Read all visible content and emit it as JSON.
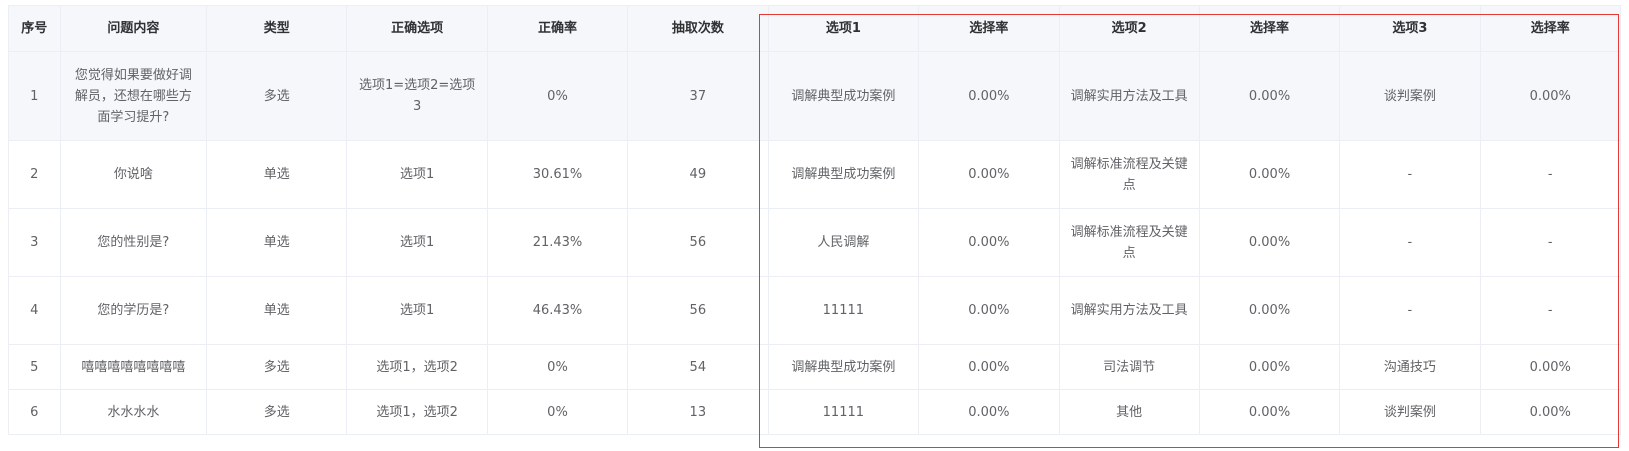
{
  "table": {
    "headers": [
      "序号",
      "问题内容",
      "类型",
      "正确选项",
      "正确率",
      "抽取次数",
      "选项1",
      "选择率",
      "选项2",
      "选择率",
      "选项3",
      "选择率"
    ],
    "rows": [
      [
        "1",
        "您觉得如果要做好调解员，还想在哪些方面学习提升?",
        "多选",
        "选项1=选项2=选项3",
        "0%",
        "37",
        "调解典型成功案例",
        "0.00%",
        "调解实用方法及工具",
        "0.00%",
        "谈判案例",
        "0.00%"
      ],
      [
        "2",
        "你说啥",
        "单选",
        "选项1",
        "30.61%",
        "49",
        "调解典型成功案例",
        "0.00%",
        "调解标准流程及关键点",
        "0.00%",
        "-",
        "-"
      ],
      [
        "3",
        "您的性别是?",
        "单选",
        "选项1",
        "21.43%",
        "56",
        "人民调解",
        "0.00%",
        "调解标准流程及关键点",
        "0.00%",
        "-",
        "-"
      ],
      [
        "4",
        "您的学历是?",
        "单选",
        "选项1",
        "46.43%",
        "56",
        "11111",
        "0.00%",
        "调解实用方法及工具",
        "0.00%",
        "-",
        "-"
      ],
      [
        "5",
        "嘻嘻嘻嘻嘻嘻嘻嘻",
        "多选",
        "选项1，选项2",
        "0%",
        "54",
        "调解典型成功案例",
        "0.00%",
        "司法调节",
        "0.00%",
        "沟通技巧",
        "0.00%"
      ],
      [
        "6",
        "水水水水",
        "多选",
        "选项1，选项2",
        "0%",
        "13",
        "11111",
        "0.00%",
        "其他",
        "0.00%",
        "谈判案例",
        "0.00%"
      ]
    ]
  },
  "colors": {
    "header_bg": "#f5f7fa",
    "border": "#ebeef5",
    "text": "#606266",
    "header_text": "#303133",
    "highlight": "#e53935"
  }
}
